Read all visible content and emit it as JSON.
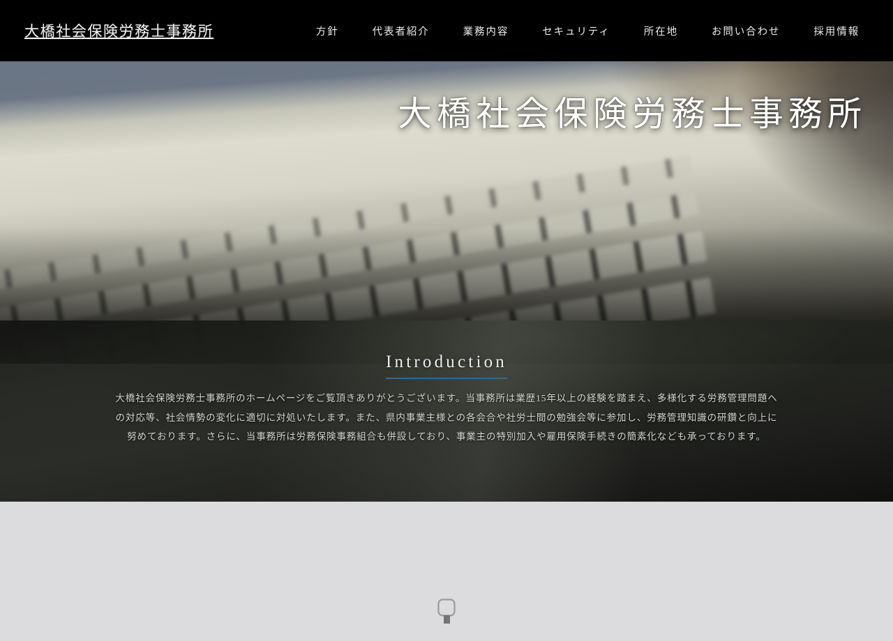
{
  "header": {
    "brand": "大橋社会保険労務士事務所",
    "nav": [
      {
        "label": "方針"
      },
      {
        "label": "代表者紹介"
      },
      {
        "label": "業務内容"
      },
      {
        "label": "セキュリティ"
      },
      {
        "label": "所在地"
      },
      {
        "label": "お問い合わせ"
      },
      {
        "label": "採用情報"
      }
    ]
  },
  "hero": {
    "title": "大橋社会保険労務士事務所",
    "background_image": "blurred-laptop-keyboard-photo"
  },
  "introduction": {
    "heading": "Introduction",
    "heading_underline_color": "#35678a",
    "paragraph": "大橋社会保険労務士事務所のホームページをご覧頂きありがとうございます。当事務所は業歴15年以上の経験を踏まえ、多様化する労務管理問題への対応等、社会情勢の変化に適切に対処いたします。また、県内事業主様との各会合や社労士間の勉強会等に参加し、労務管理知識の研鑽と向上に努めております。さらに、当事務所は労務保険事務組合も併設しており、事業主の特別加入や雇用保険手続きの簡素化なども承っております。",
    "lines": [
      "大橋社会保険労務士事務所のホームページをご覧頂きありがとうございます。",
      "当事務所は業歴15年以上の経験を踏まえ、多様化する労務管理問題への対応等、社会情勢の変化に適切に対処いたします。また、県内事業主様との各会合や社労士間の勉強",
      "会等に参加し、労務管理知識の研鑽と向上に努めております。さらに、当事務所は労務保険事務組合も併設しており、事業主の特別加入や雇用保険手続きの簡素化なども承",
      "っております。"
    ]
  },
  "lower_section": {
    "background_color": "#dcdcde",
    "placeholder_icon": "broken-image-icon"
  },
  "theme": {
    "header_background": "#000000",
    "header_text": "#ececec",
    "hero_title_color": "#ffffff",
    "intro_background": "#1f211d",
    "intro_text": "#cfd2cd",
    "accent_underline": "#35678a",
    "light_background": "#dcdcde"
  }
}
